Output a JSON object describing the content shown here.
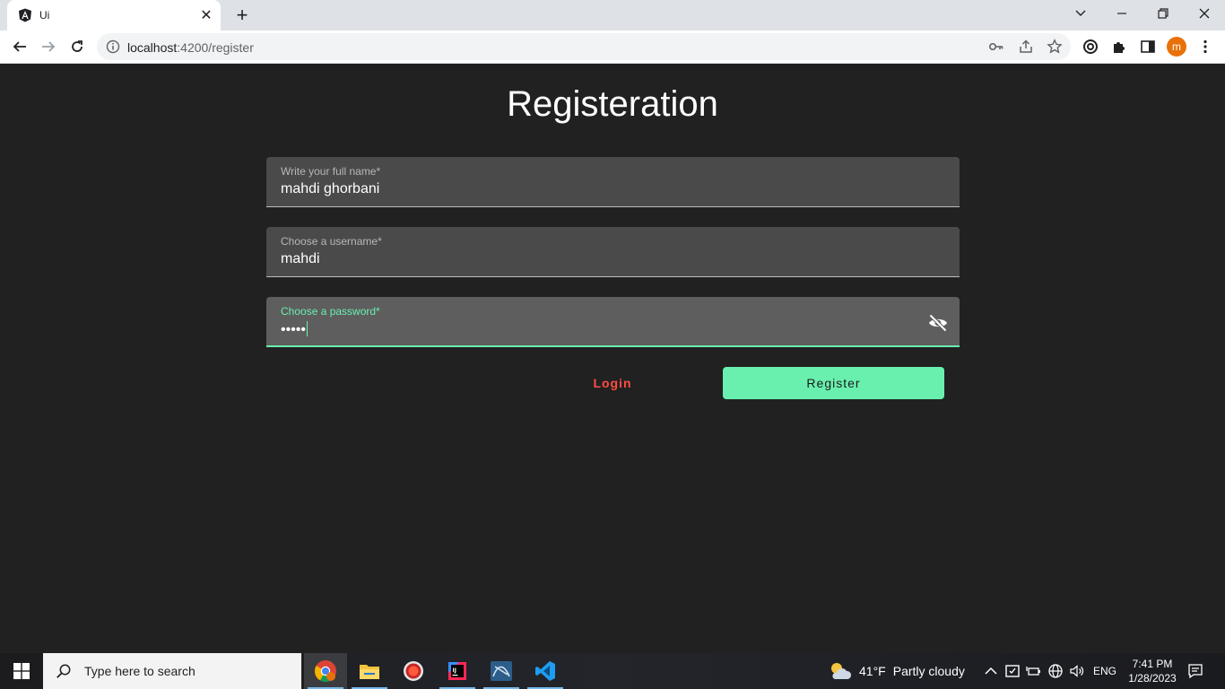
{
  "browser": {
    "tab_title": "Ui",
    "url_host": "localhost",
    "url_path": ":4200/register"
  },
  "page": {
    "title": "Registeration",
    "fields": [
      {
        "label": "Write your full name*",
        "value": "mahdi ghorbani"
      },
      {
        "label": "Choose a username*",
        "value": "mahdi"
      },
      {
        "label": "Choose a password*",
        "value": "•••••"
      }
    ],
    "login_label": "Login",
    "register_label": "Register"
  },
  "profile_initial": "m",
  "taskbar": {
    "search_placeholder": "Type here to search",
    "weather_temp": "41°F",
    "weather_desc": "Partly cloudy",
    "language": "ENG",
    "time": "7:41 PM",
    "date": "1/28/2023"
  },
  "colors": {
    "accent": "#69f0ae",
    "warn": "#ff4d40",
    "background": "#212121"
  }
}
